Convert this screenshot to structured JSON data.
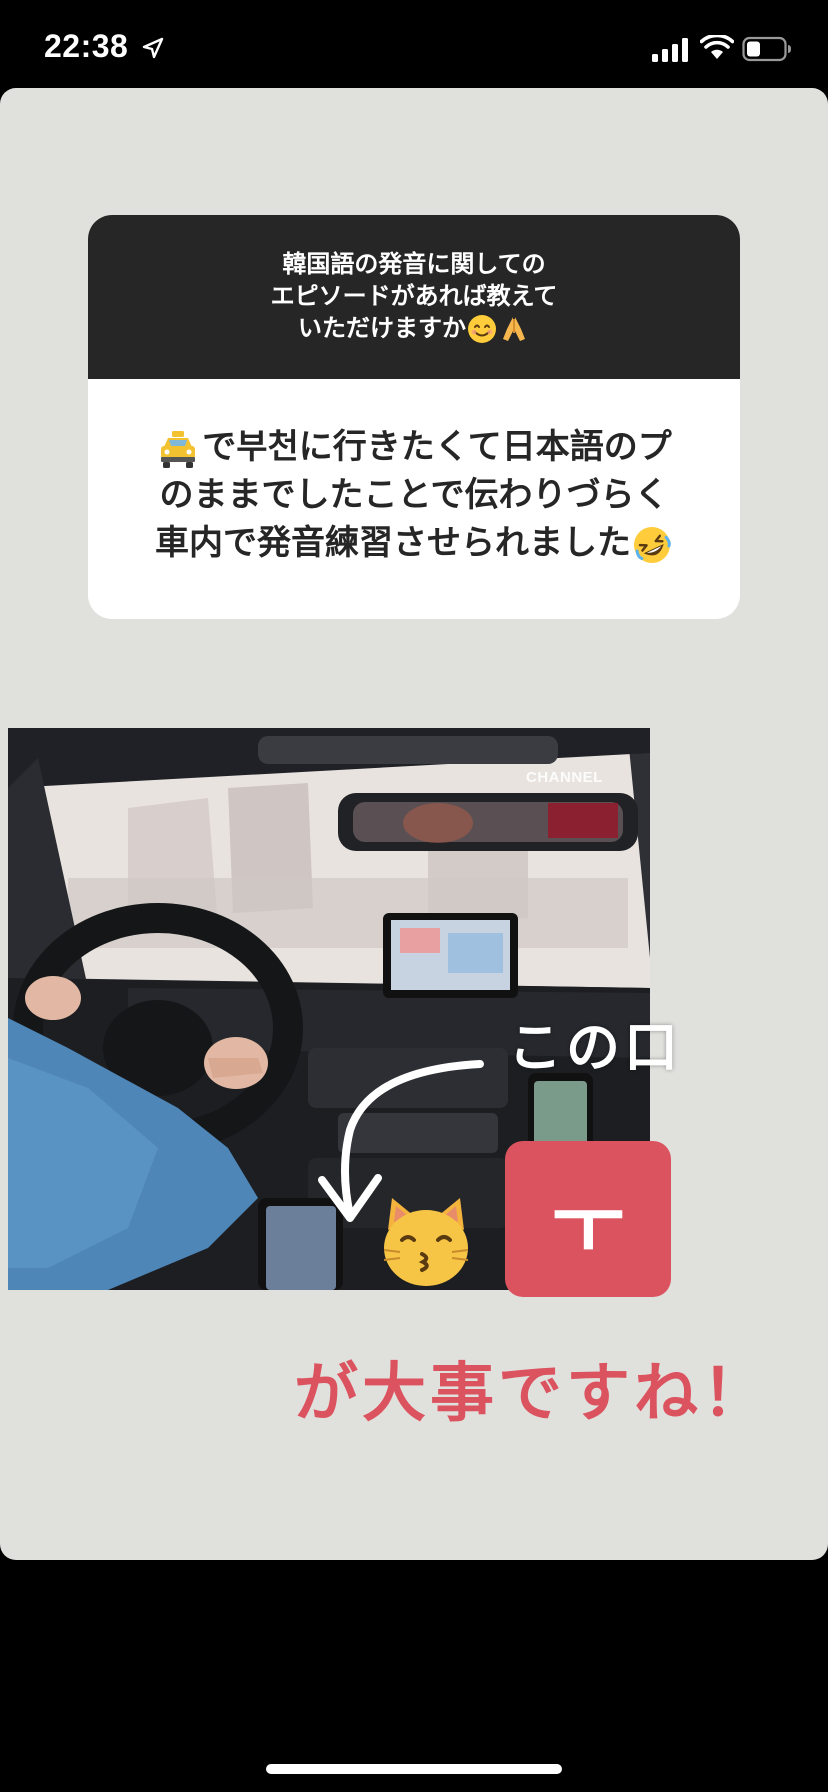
{
  "status_bar": {
    "time": "22:38",
    "location_icon": "location-arrow-icon",
    "signal_icon": "cellular-signal-icon",
    "wifi_icon": "wifi-icon",
    "battery_icon": "battery-icon"
  },
  "question_sticker": {
    "question_lines": [
      "韓国語の発音に関しての",
      "エピソードがあれば教えて",
      "いただけますか"
    ],
    "question_emojis": [
      "smiling-face-emoji",
      "folded-hands-emoji"
    ],
    "answer_lines": [
      "で부천に行きたくて日本語のプ",
      "のままでしたことで伝わりづらく",
      "車内で発音練習させられました"
    ],
    "answer_emojis": [
      "taxi-emoji",
      "rolling-laughing-emoji"
    ]
  },
  "photo": {
    "watermark": "CHANNEL"
  },
  "annotations": {
    "kono_kuchi": "この口",
    "hangul_tile": "ㅜ",
    "daiji": "が大事ですね！",
    "cat_emoji": "kissing-cat-emoji"
  },
  "colors": {
    "story_bg": "#e0e0dd",
    "question_bg": "#262626",
    "accent_red": "#dc5360"
  }
}
